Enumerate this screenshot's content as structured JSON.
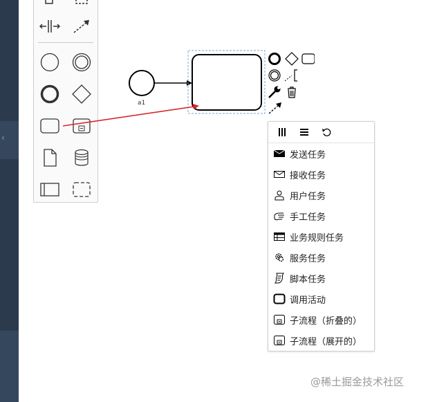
{
  "canvas": {
    "start_event_label": "a1"
  },
  "palette": {
    "entries": [
      {
        "name": "space-tool",
        "icon": "space-tool-icon"
      },
      {
        "name": "global-connect-tool",
        "icon": "connect-icon"
      },
      {
        "name": "create-start-event",
        "icon": "start-event-icon"
      },
      {
        "name": "create-intermediate-event",
        "icon": "intermediate-event-icon"
      },
      {
        "name": "create-end-event",
        "icon": "end-event-icon"
      },
      {
        "name": "create-gateway",
        "icon": "gateway-icon"
      },
      {
        "name": "create-task",
        "icon": "task-icon"
      },
      {
        "name": "create-subprocess",
        "icon": "subprocess-icon"
      },
      {
        "name": "create-data-object",
        "icon": "data-object-icon"
      },
      {
        "name": "create-data-store",
        "icon": "data-store-icon"
      },
      {
        "name": "create-pool",
        "icon": "pool-icon"
      },
      {
        "name": "create-group",
        "icon": "group-icon"
      }
    ]
  },
  "replace_menu": {
    "header_icons": [
      "parallel-multi-instance-icon",
      "sequential-multi-instance-icon",
      "loop-icon"
    ],
    "items": [
      {
        "label": "发送任务",
        "icon": "send-task-icon"
      },
      {
        "label": "接收任务",
        "icon": "receive-task-icon"
      },
      {
        "label": "用户任务",
        "icon": "user-task-icon"
      },
      {
        "label": "手工任务",
        "icon": "manual-task-icon"
      },
      {
        "label": "业务规则任务",
        "icon": "business-rule-task-icon"
      },
      {
        "label": "服务任务",
        "icon": "service-task-icon"
      },
      {
        "label": "脚本任务",
        "icon": "script-task-icon"
      },
      {
        "label": "调用活动",
        "icon": "call-activity-icon"
      },
      {
        "label": "子流程（折叠的）",
        "icon": "collapsed-subprocess-icon"
      },
      {
        "label": "子流程（展开的）",
        "icon": "expanded-subprocess-icon"
      }
    ]
  },
  "colors": {
    "annotation_arrow": "#d9262b",
    "selection_outline": "#7aa7d6",
    "rail": "#2b3a4c"
  },
  "watermark": "@稀土掘金技术社区"
}
